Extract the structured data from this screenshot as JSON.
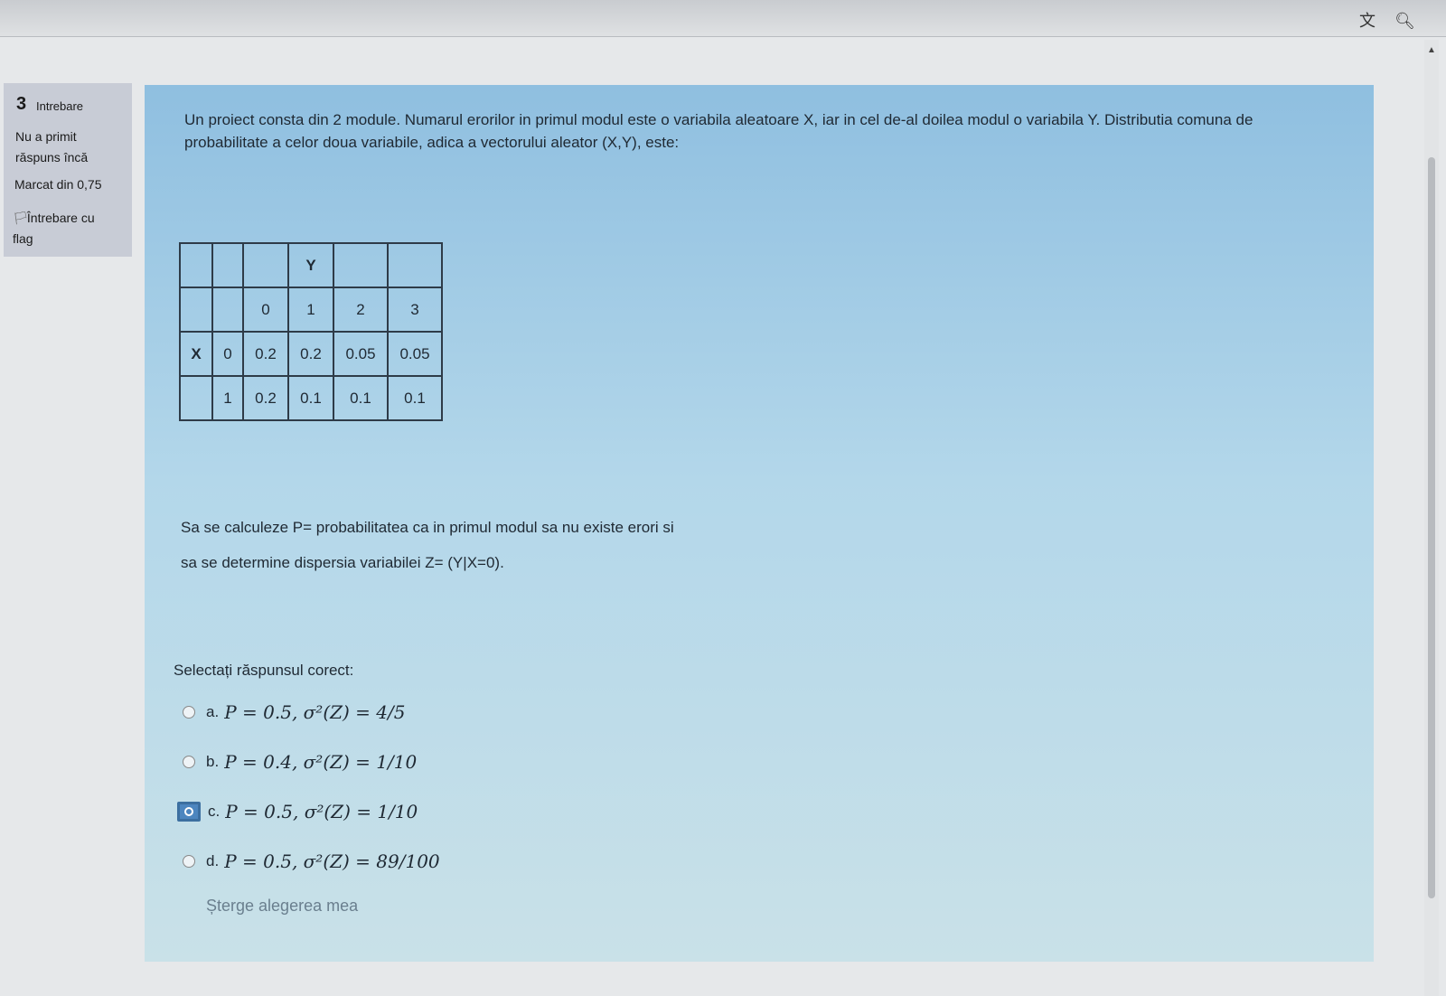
{
  "toolbar": {
    "translate_icon": "translate-icon",
    "zoom_icon": "zoom-icon"
  },
  "question_info": {
    "number": "3",
    "label": "Intrebare",
    "state_line1": "Nu a primit",
    "state_line2": "răspuns încă",
    "grade": "Marcat din 0,75",
    "flag_line1": "Întrebare cu",
    "flag_line2": "flag"
  },
  "question": {
    "text": "Un proiect consta din 2 module. Numarul erorilor in primul modul este  o variabila aleatoare X, iar in cel de-al doilea modul o variabila Y. Distributia comuna de probabilitate a celor doua variabile, adica a vectorului aleator (X,Y), este:",
    "table": {
      "rows": [
        [
          "",
          "",
          "",
          "Y",
          "",
          ""
        ],
        [
          "",
          "",
          "0",
          "1",
          "2",
          "3"
        ],
        [
          "X",
          "0",
          "0.2",
          "0.2",
          "0.05",
          "0.05"
        ],
        [
          "",
          "1",
          "0.2",
          "0.1",
          "0.1",
          "0.1"
        ]
      ]
    },
    "task_line1": "Sa se calculeze P= probabilitatea ca in primul modul sa nu existe  erori si",
    "task_line2": "sa se determine dispersia  variabilei Z= (Y|X=0)."
  },
  "answers": {
    "prompt": "Selectați răspunsul corect:",
    "options": [
      {
        "letter": "a.",
        "P": "0.5",
        "variance": "4/5",
        "selected": false
      },
      {
        "letter": "b.",
        "P": "0.4",
        "variance": "1/10",
        "selected": false
      },
      {
        "letter": "c.",
        "P": "0.5",
        "variance": "1/10",
        "selected": true
      },
      {
        "letter": "d.",
        "P": "0.5",
        "variance": "89/100",
        "selected": false
      }
    ],
    "clear_label": "Șterge alegerea mea"
  },
  "colors": {
    "panel_gradient_top": "#8fbfe0",
    "panel_gradient_bottom": "#c9e1e8",
    "info_bg": "#c8ccd6",
    "selected_radio": "#4d86bf"
  }
}
